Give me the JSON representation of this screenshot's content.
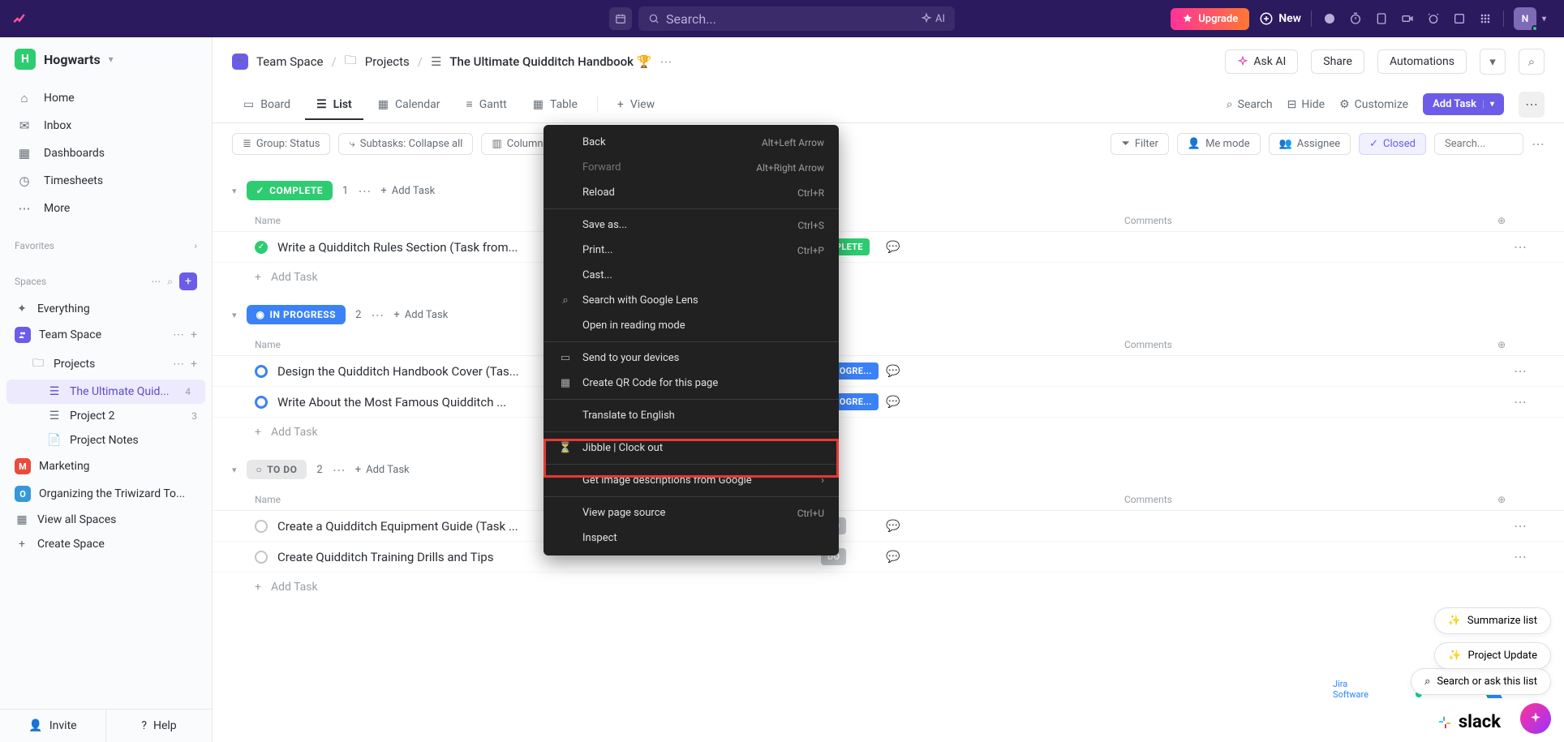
{
  "topbar": {
    "search_placeholder": "Search...",
    "ai_label": "AI",
    "upgrade": "Upgrade",
    "new": "New",
    "avatar_initial": "N"
  },
  "workspace": {
    "badge": "H",
    "name": "Hogwarts"
  },
  "nav": {
    "home": "Home",
    "inbox": "Inbox",
    "dashboards": "Dashboards",
    "timesheets": "Timesheets",
    "more": "More"
  },
  "sidebar": {
    "favorites_label": "Favorites",
    "spaces_label": "Spaces",
    "everything": "Everything",
    "team_space": "Team Space",
    "projects": "Projects",
    "ultimate_quid": "The Ultimate Quid...",
    "ultimate_quid_count": "4",
    "project2": "Project 2",
    "project2_count": "3",
    "project_notes": "Project Notes",
    "marketing": "Marketing",
    "organizing": "Organizing the Triwizard To...",
    "view_all_spaces": "View all Spaces",
    "create_space": "Create Space",
    "invite": "Invite",
    "help": "Help"
  },
  "breadcrumb": {
    "team_space": "Team Space",
    "projects": "Projects",
    "title": "The Ultimate Quidditch Handbook 🏆",
    "ask_ai": "Ask AI",
    "share": "Share",
    "automations": "Automations"
  },
  "views": {
    "board": "Board",
    "list": "List",
    "calendar": "Calendar",
    "gantt": "Gantt",
    "table": "Table",
    "view": "View",
    "search": "Search",
    "hide": "Hide",
    "customize": "Customize",
    "add_task": "Add Task"
  },
  "filter_bar": {
    "group": "Group: Status",
    "subtasks": "Subtasks: Collapse all",
    "columns": "Columns",
    "filter": "Filter",
    "me_mode": "Me mode",
    "assignee": "Assignee",
    "closed": "Closed",
    "search_placeholder": "Search..."
  },
  "columns": {
    "name": "Name",
    "comments": "Comments"
  },
  "groups": {
    "complete": {
      "label": "COMPLETE",
      "count": "1",
      "add_task": "Add Task"
    },
    "in_progress": {
      "label": "IN PROGRESS",
      "count": "2",
      "add_task": "Add Task"
    },
    "to_do": {
      "label": "TO DO",
      "count": "2",
      "add_task": "Add Task"
    },
    "add_task_row": "Add Task"
  },
  "tasks": {
    "complete": [
      {
        "name": "Write a Quidditch Rules Section (Task from...",
        "status_pill": "MPLETE"
      }
    ],
    "in_progress": [
      {
        "name": "Design the Quidditch Handbook Cover (Tas...",
        "status_pill": "PROGRE..."
      },
      {
        "name": "Write About the Most Famous Quidditch ...",
        "status_pill": "PROGRE..."
      }
    ],
    "to_do": [
      {
        "name": "Create a Quidditch Equipment Guide (Task ...",
        "status_pill": "DO"
      },
      {
        "name": "Create Quidditch Training Drills and Tips",
        "status_pill": "DO"
      }
    ]
  },
  "context_menu": {
    "back": "Back",
    "back_sc": "Alt+Left Arrow",
    "forward": "Forward",
    "forward_sc": "Alt+Right Arrow",
    "reload": "Reload",
    "reload_sc": "Ctrl+R",
    "save_as": "Save as...",
    "save_as_sc": "Ctrl+S",
    "print": "Print...",
    "print_sc": "Ctrl+P",
    "cast": "Cast...",
    "search_lens": "Search with Google Lens",
    "reading_mode": "Open in reading mode",
    "send_devices": "Send to your devices",
    "create_qr": "Create QR Code for this page",
    "translate": "Translate to English",
    "jibble": "Jibble | Clock out",
    "image_desc": "Get image descriptions from Google",
    "view_source": "View page source",
    "view_source_sc": "Ctrl+U",
    "inspect": "Inspect"
  },
  "floating": {
    "summarize": "Summarize list",
    "project_update": "Project Update",
    "search_ask": "Search or ask this list",
    "jira": "Jira Software",
    "slack": "slack"
  },
  "colors": {
    "primary": "#6c5ce7",
    "topbar": "#2b1a5e",
    "complete": "#2ecc71",
    "progress": "#3b82f6"
  }
}
